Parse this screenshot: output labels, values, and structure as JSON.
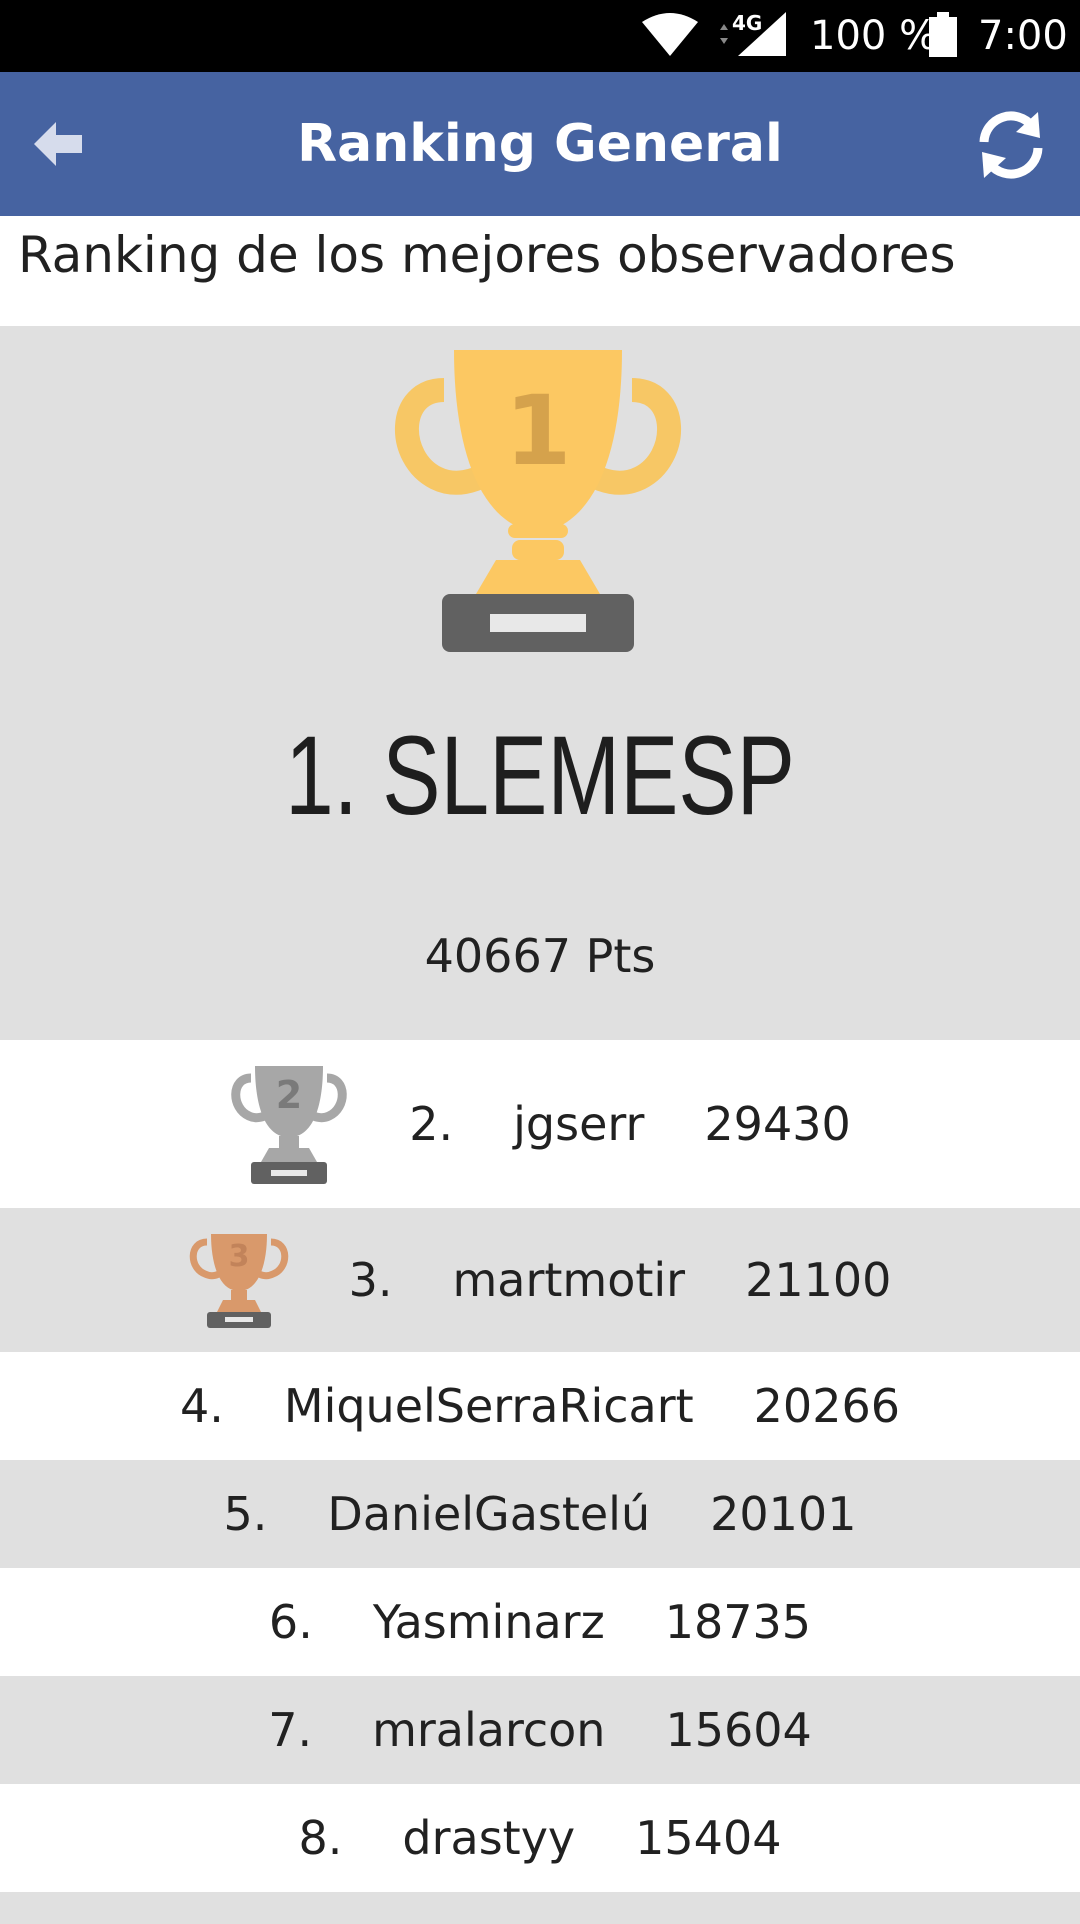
{
  "status_bar": {
    "network": "4G",
    "battery": "100 %",
    "time": "7:00"
  },
  "app_bar": {
    "title": "Ranking General",
    "back_icon": "arrow-left-icon",
    "refresh_icon": "refresh-icon"
  },
  "subtitle": "Ranking de los mejores observadores",
  "winner": {
    "trophy_number": "1",
    "name": "1. SLEMESP",
    "points": "40667 Pts"
  },
  "ranking": [
    {
      "position": "2.",
      "name": "jgserr",
      "points": "29430",
      "trophy": "2"
    },
    {
      "position": "3.",
      "name": "martmotir",
      "points": "21100",
      "trophy": "3"
    },
    {
      "position": "4.",
      "name": "MiquelSerraRicart",
      "points": "20266"
    },
    {
      "position": "5.",
      "name": "DanielGastelú",
      "points": "20101"
    },
    {
      "position": "6.",
      "name": "Yasminarz",
      "points": "18735"
    },
    {
      "position": "7.",
      "name": "mralarcon",
      "points": "15604"
    },
    {
      "position": "8.",
      "name": "drastyy",
      "points": "15404"
    }
  ],
  "colors": {
    "app_bar": "#4663a1",
    "gold": "#fcc862",
    "silver": "#a7a7a7",
    "bronze": "#d9996b",
    "base": "#616161"
  }
}
